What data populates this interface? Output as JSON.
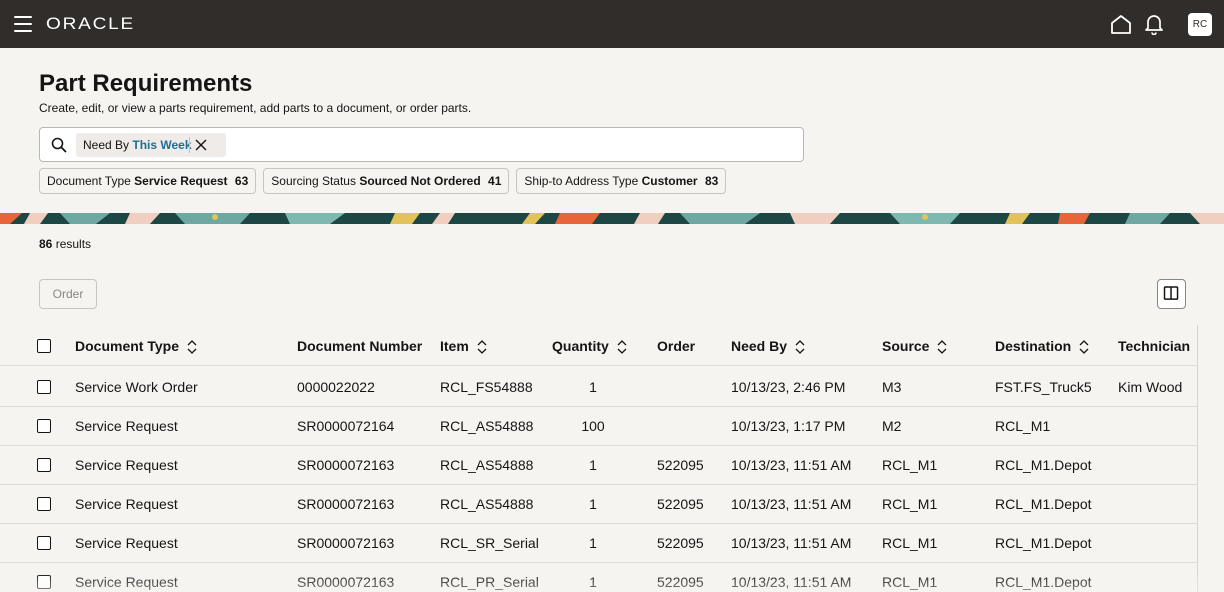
{
  "header": {
    "logo": "ORACLE",
    "avatar_initials": "RC",
    "icons": [
      "hamburger-menu-icon",
      "home-icon",
      "bell-icon"
    ]
  },
  "page": {
    "title": "Part Requirements",
    "subtitle": "Create, edit, or view a parts requirement, add parts to a document, or order parts."
  },
  "search": {
    "chip_label": "Need By",
    "chip_value": "This Week"
  },
  "facets": [
    {
      "label": "Document Type",
      "value": "Service Request",
      "count": "63"
    },
    {
      "label": "Sourcing Status",
      "value": "Sourced Not Ordered",
      "count": "41"
    },
    {
      "label": "Ship-to Address Type",
      "value": "Customer",
      "count": "83"
    }
  ],
  "results": {
    "count": "86",
    "label": "results"
  },
  "toolbar": {
    "order_label": "Order"
  },
  "table": {
    "columns": [
      "Document Type",
      "Document Number",
      "Item",
      "Quantity",
      "Order",
      "Need By",
      "Source",
      "Destination",
      "Technician"
    ],
    "rows": [
      [
        "Service Work Order",
        "0000022022",
        "RCL_FS54888",
        "1",
        "",
        "10/13/23, 2:46 PM",
        "M3",
        "FST.FS_Truck5",
        "Kim Wood"
      ],
      [
        "Service Request",
        "SR0000072164",
        "RCL_AS54888",
        "100",
        "",
        "10/13/23, 1:17 PM",
        "M2",
        "RCL_M1",
        ""
      ],
      [
        "Service Request",
        "SR0000072163",
        "RCL_AS54888",
        "1",
        "522095",
        "10/13/23, 11:51 AM",
        "RCL_M1",
        "RCL_M1.Depot",
        ""
      ],
      [
        "Service Request",
        "SR0000072163",
        "RCL_AS54888",
        "1",
        "522095",
        "10/13/23, 11:51 AM",
        "RCL_M1",
        "RCL_M1.Depot",
        ""
      ],
      [
        "Service Request",
        "SR0000072163",
        "RCL_SR_Serial",
        "1",
        "522095",
        "10/13/23, 11:51 AM",
        "RCL_M1",
        "RCL_M1.Depot",
        ""
      ],
      [
        "Service Request",
        "SR0000072163",
        "RCL_PR_Serial",
        "1",
        "522095",
        "10/13/23, 11:51 AM",
        "RCL_M1",
        "RCL_M1.Depot",
        ""
      ]
    ]
  },
  "colors": {
    "topbar": "#312d2a",
    "background": "#f6f4f1",
    "link": "#1f6e94",
    "banner_dark": "#1c4744",
    "banner_teal": "#6fa8a2",
    "banner_orange": "#e8643a",
    "banner_pink": "#f1cfc0",
    "banner_yellow": "#e2c25b"
  }
}
